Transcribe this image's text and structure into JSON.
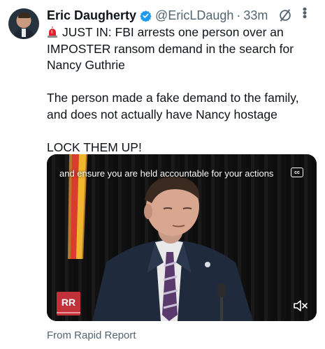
{
  "author": {
    "name": "Eric Daugherty",
    "handle": "@EricLDaugh",
    "separator": "·",
    "time": "33m"
  },
  "icons": {
    "verified": "verified-badge-icon",
    "grok": "grok-icon",
    "more": "more-options-icon",
    "siren": "siren-emoji-icon",
    "cc": "closed-captions-icon",
    "mute": "muted-speaker-icon"
  },
  "colors": {
    "verified_blue": "#1d9bf0",
    "muted_text": "#536471",
    "brand_red": "#c0313a"
  },
  "tweet": {
    "line1": "JUST IN: FBI arrests one person over an IMPOSTER ransom demand in the search for Nancy Guthrie",
    "line2": "The person made a fake demand to the family, and does not actually have Nancy hostage",
    "line3": "LOCK THEM UP!"
  },
  "video": {
    "caption": "and ensure you are held accountable for your actions",
    "cc_label": "cc",
    "logo_text": "RR"
  },
  "source": {
    "label": "From Rapid Report"
  }
}
